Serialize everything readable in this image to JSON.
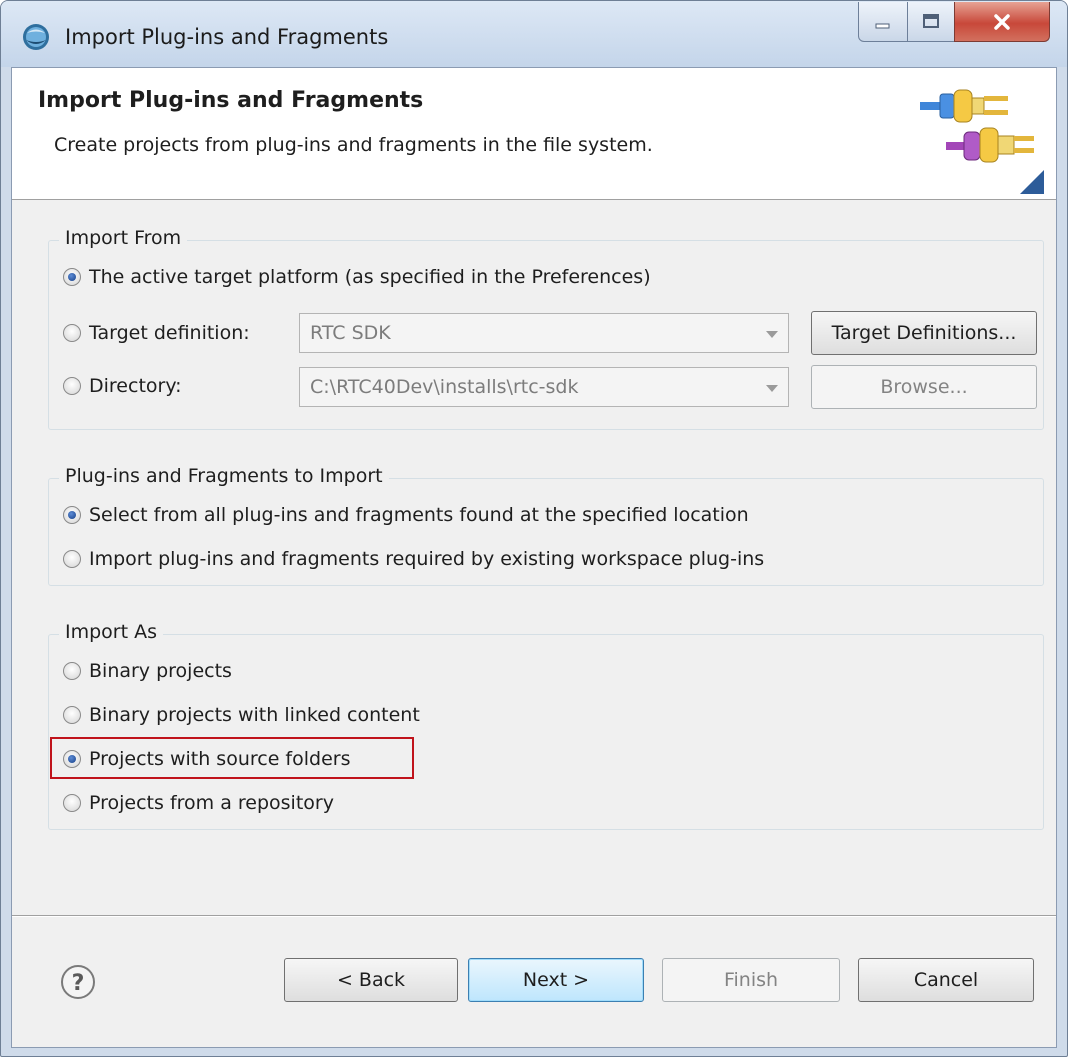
{
  "window": {
    "title": "Import Plug-ins and Fragments"
  },
  "banner": {
    "title": "Import Plug-ins and Fragments",
    "description": "Create projects from plug-ins and fragments in the file system."
  },
  "import_from": {
    "label": "Import From",
    "options": [
      {
        "label": "The active target platform (as specified in the Preferences)",
        "checked": true
      },
      {
        "label": "Target definition:",
        "checked": false
      },
      {
        "label": "Directory:",
        "checked": false
      }
    ],
    "target_definition_value": "RTC SDK",
    "directory_value": "C:\\RTC40Dev\\installs\\rtc-sdk",
    "target_definitions_button": "Target Definitions...",
    "browse_button": "Browse..."
  },
  "to_import": {
    "label": "Plug-ins and Fragments to Import",
    "options": [
      {
        "label": "Select from all plug-ins and fragments found at the specified location",
        "checked": true
      },
      {
        "label": "Import plug-ins and fragments required by existing workspace plug-ins",
        "checked": false
      }
    ]
  },
  "import_as": {
    "label": "Import As",
    "options": [
      {
        "label": "Binary projects",
        "checked": false
      },
      {
        "label": "Binary projects with linked content",
        "checked": false
      },
      {
        "label": "Projects with source folders",
        "checked": true
      },
      {
        "label": "Projects from a repository",
        "checked": false
      }
    ]
  },
  "buttons": {
    "back": "< Back",
    "next": "Next >",
    "finish": "Finish",
    "cancel": "Cancel"
  },
  "colors": {
    "highlight": "#c0131b",
    "title_bar": "#c4d5ea",
    "dialog_bg": "#f0f0f0"
  }
}
